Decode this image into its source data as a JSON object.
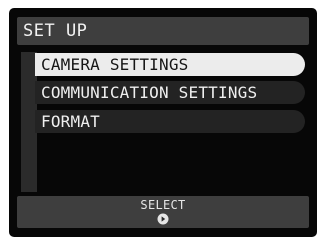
{
  "header": {
    "title": "SET UP"
  },
  "menu": {
    "items": [
      {
        "label": "CAMERA SETTINGS",
        "selected": true
      },
      {
        "label": "COMMUNICATION SETTINGS",
        "selected": false
      },
      {
        "label": "FORMAT",
        "selected": false
      }
    ]
  },
  "footer": {
    "action_label": "SELECT",
    "action_icon": "right-arrow-circle-icon"
  },
  "colors": {
    "screen_background": "#070707",
    "bar_background": "#3e3e3e",
    "selected_item": "#ececec",
    "unselected_item": "#232323",
    "text_light": "#efefef",
    "text_dark": "#161616"
  }
}
